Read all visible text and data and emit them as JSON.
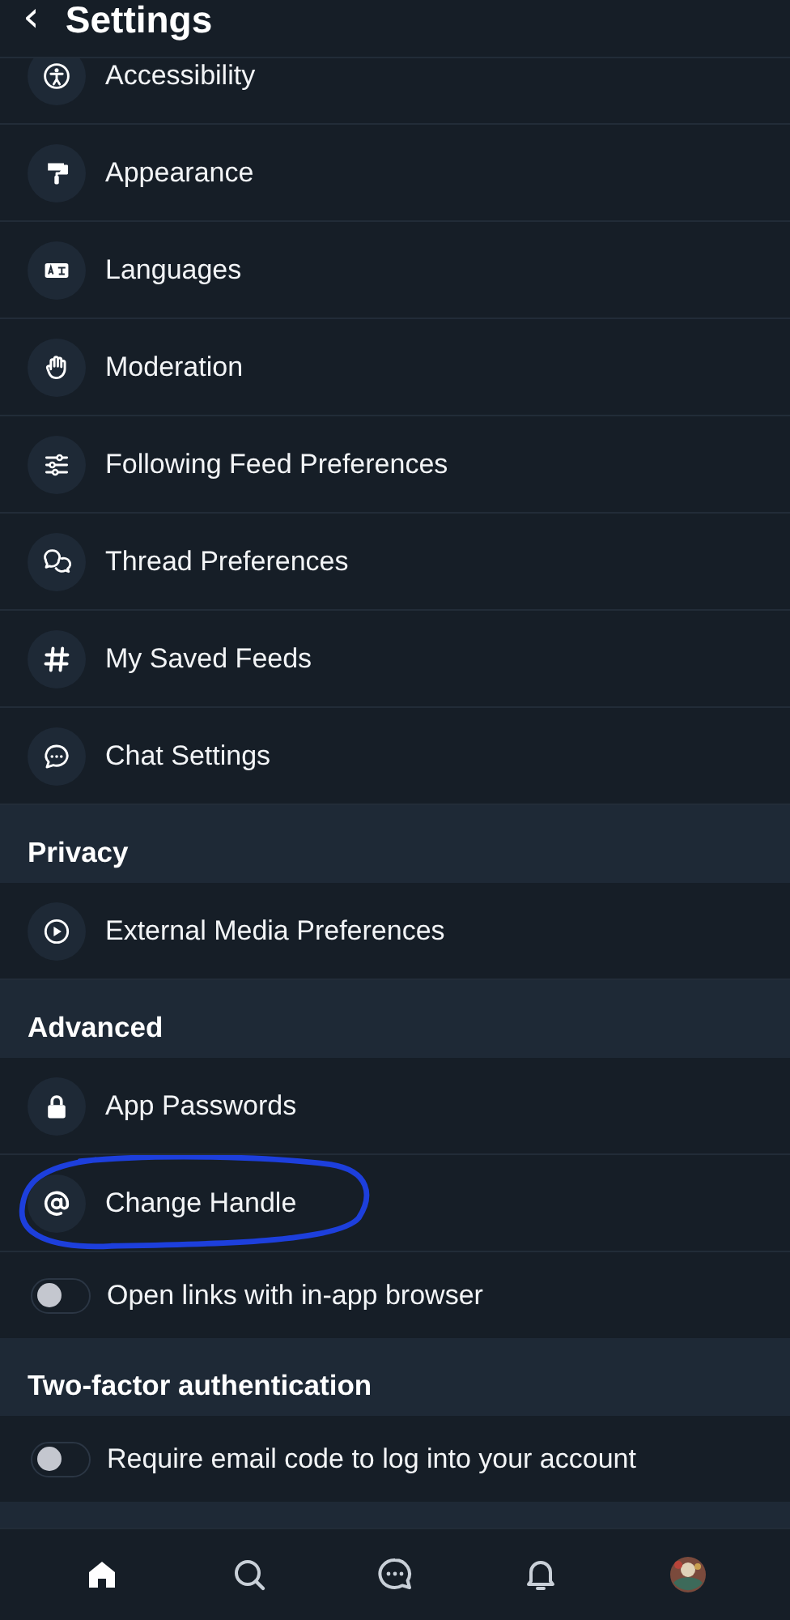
{
  "header": {
    "back": "‹",
    "title": "Settings"
  },
  "sections": [
    {
      "items": [
        {
          "kind": "link",
          "label": "Accessibility"
        },
        {
          "kind": "link",
          "label": "Appearance"
        },
        {
          "kind": "link",
          "label": "Languages"
        },
        {
          "kind": "link",
          "label": "Moderation"
        },
        {
          "kind": "link",
          "label": "Following Feed Preferences"
        },
        {
          "kind": "link",
          "label": "Thread Preferences"
        },
        {
          "kind": "link",
          "label": "My Saved Feeds"
        },
        {
          "kind": "link",
          "label": "Chat Settings"
        }
      ]
    },
    {
      "title": "Privacy",
      "items": [
        {
          "kind": "link",
          "label": "External Media Preferences"
        }
      ]
    },
    {
      "title": "Advanced",
      "items": [
        {
          "kind": "link",
          "label": "App Passwords"
        },
        {
          "kind": "link",
          "label": "Change Handle",
          "annotated": true
        },
        {
          "kind": "toggle",
          "label": "Open links with in-app browser",
          "on": false
        }
      ]
    },
    {
      "title": "Two-factor authentication",
      "items": [
        {
          "kind": "toggle",
          "label": "Require email code to log into your account",
          "on": false
        }
      ]
    }
  ],
  "tab_bar": [
    {
      "kind": "home",
      "selected": true
    },
    {
      "kind": "search",
      "selected": false
    },
    {
      "kind": "chat",
      "selected": false
    },
    {
      "kind": "bell",
      "selected": false
    },
    {
      "kind": "avatar",
      "selected": false
    }
  ]
}
